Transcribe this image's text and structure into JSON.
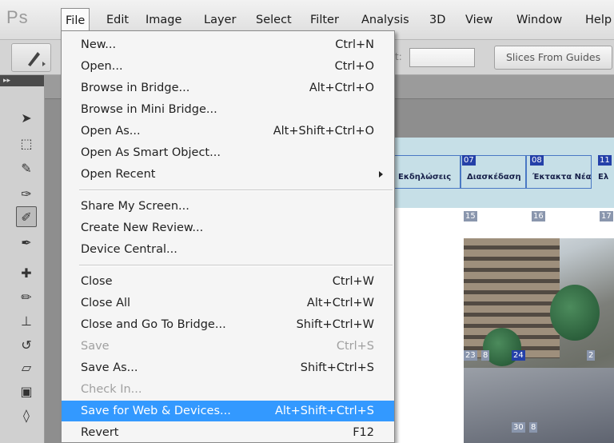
{
  "app": {
    "logo": "Ps"
  },
  "menubar": {
    "items": [
      "File",
      "Edit",
      "Image",
      "Layer",
      "Select",
      "Filter",
      "Analysis",
      "3D",
      "View",
      "Window",
      "Help"
    ],
    "active": "File"
  },
  "options": {
    "slices_button": "Slices From Guides"
  },
  "file_menu": {
    "items": [
      {
        "label": "New...",
        "shortcut": "Ctrl+N"
      },
      {
        "label": "Open...",
        "shortcut": "Ctrl+O"
      },
      {
        "label": "Browse in Bridge...",
        "shortcut": "Alt+Ctrl+O"
      },
      {
        "label": "Browse in Mini Bridge...",
        "shortcut": ""
      },
      {
        "label": "Open As...",
        "shortcut": "Alt+Shift+Ctrl+O"
      },
      {
        "label": "Open As Smart Object...",
        "shortcut": ""
      },
      {
        "label": "Open Recent",
        "shortcut": "",
        "submenu": true
      },
      {
        "label": "Share My Screen...",
        "shortcut": ""
      },
      {
        "label": "Create New Review...",
        "shortcut": ""
      },
      {
        "label": "Device Central...",
        "shortcut": ""
      },
      {
        "label": "Close",
        "shortcut": "Ctrl+W"
      },
      {
        "label": "Close All",
        "shortcut": "Alt+Ctrl+W"
      },
      {
        "label": "Close and Go To Bridge...",
        "shortcut": "Shift+Ctrl+W"
      },
      {
        "label": "Save",
        "shortcut": "Ctrl+S",
        "disabled": true
      },
      {
        "label": "Save As...",
        "shortcut": "Shift+Ctrl+S"
      },
      {
        "label": "Check In...",
        "shortcut": "",
        "disabled": true
      },
      {
        "label": "Save for Web & Devices...",
        "shortcut": "Alt+Shift+Ctrl+S",
        "highlighted": true
      },
      {
        "label": "Revert",
        "shortcut": "F12"
      }
    ],
    "highlight_color": "#3399ff"
  },
  "canvas": {
    "nav_items": [
      "Εκδηλώσεις",
      "Διασκέδαση",
      "Έκτακτα Νέα",
      "Ελ"
    ],
    "slice_tags": [
      "07",
      "08",
      "11",
      "15",
      "16",
      "17",
      "23",
      "24",
      "30",
      "8",
      "8",
      "8",
      "2"
    ]
  }
}
